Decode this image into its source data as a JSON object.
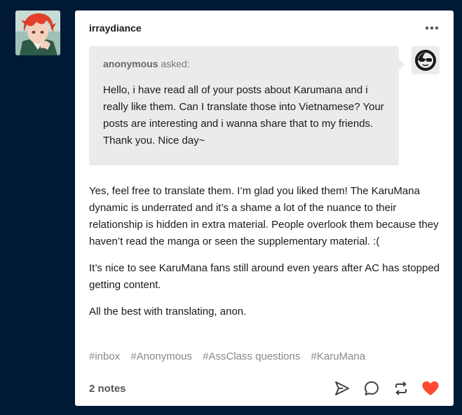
{
  "post": {
    "blog_name": "irraydiance",
    "asker": {
      "name": "anonymous",
      "suffix": "asked:"
    },
    "question": "Hello, i have read all of your posts about Karumana and i really like them. Can I translate those into Vietnamese? Your posts are interesting and i wanna share that to my friends. Thank you. Nice day~",
    "answer": [
      "Yes, feel free to translate them. I’m glad you liked them! The KaruMana dynamic is underrated and it’s a shame a lot of the nuance to their relationship is hidden in extra material. People overlook them because they haven’t read the manga or seen the supplementary material. :(",
      "It’s nice to see KaruMana fans still around even years after AC has stopped getting content.",
      "All the best with translating, anon."
    ],
    "tags": [
      "#inbox",
      "#Anonymous",
      "#AssClass questions",
      "#KaruMana"
    ],
    "notes": "2 notes"
  },
  "icons": {
    "more": "more-horizontal-icon",
    "share": "share-send-icon",
    "reply": "reply-bubble-icon",
    "reblog": "reblog-icon",
    "like": "heart-icon"
  },
  "colors": {
    "background": "#001935",
    "card": "#ffffff",
    "ask_box": "#ebebeb",
    "tag_text": "#888888",
    "like": "#ff4930"
  }
}
